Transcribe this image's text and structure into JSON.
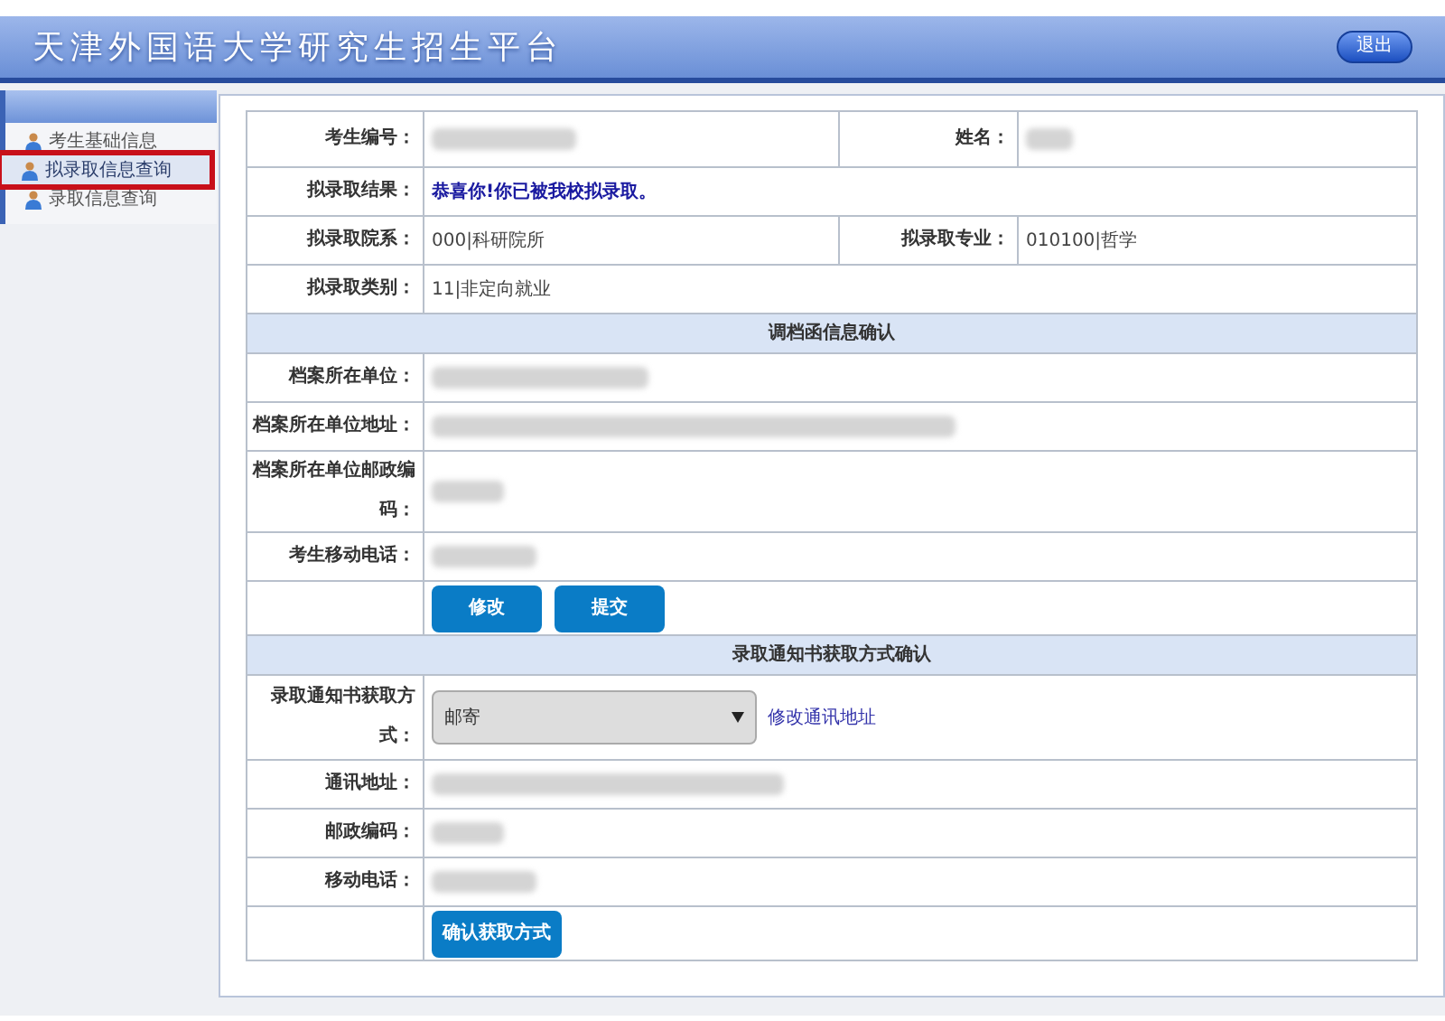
{
  "header": {
    "title": "天津外国语大学研究生招生平台",
    "logout_button": "退出"
  },
  "sidebar": {
    "items": [
      {
        "label": "考生基础信息",
        "selected": false,
        "highlighted": false
      },
      {
        "label": "拟录取信息查询",
        "selected": true,
        "highlighted": true
      },
      {
        "label": "录取信息查询",
        "selected": false,
        "highlighted": false
      }
    ]
  },
  "rows": [
    {
      "kind": "fields",
      "cells": [
        {
          "label": "考生编号：",
          "redacted": true
        },
        {
          "label": "姓名：",
          "redacted": true
        }
      ]
    },
    {
      "kind": "fields",
      "cells": [
        {
          "label": "拟录取结果：",
          "value": "恭喜你!你已被我校拟录取。",
          "emphasis": true
        }
      ]
    },
    {
      "kind": "fields",
      "cells": [
        {
          "label": "拟录取院系：",
          "value": "000|科研院所"
        },
        {
          "label": "拟录取专业：",
          "value": "010100|哲学"
        }
      ]
    },
    {
      "kind": "fields",
      "cells": [
        {
          "label": "拟录取类别：",
          "value": "11|非定向就业"
        }
      ]
    },
    {
      "kind": "section",
      "title": "调档函信息确认"
    },
    {
      "kind": "fields",
      "cells": [
        {
          "label": "档案所在单位：",
          "redacted": true
        }
      ]
    },
    {
      "kind": "fields",
      "cells": [
        {
          "label": "档案所在单位地址：",
          "redacted": true
        }
      ]
    },
    {
      "kind": "fields",
      "cells": [
        {
          "label": "档案所在单位邮政编码：",
          "redacted": true
        }
      ]
    },
    {
      "kind": "fields",
      "cells": [
        {
          "label": "考生移动电话：",
          "redacted": true
        }
      ]
    },
    {
      "kind": "buttons",
      "buttons": [
        "修改",
        "提交"
      ]
    },
    {
      "kind": "section",
      "title": "录取通知书获取方式确认"
    },
    {
      "kind": "select",
      "label": "录取通知书获取方式：",
      "value": "邮寄",
      "link": "修改通讯地址"
    },
    {
      "kind": "fields",
      "cells": [
        {
          "label": "通讯地址：",
          "redacted": true
        }
      ]
    },
    {
      "kind": "fields",
      "cells": [
        {
          "label": "邮政编码：",
          "redacted": true
        }
      ]
    },
    {
      "kind": "fields",
      "cells": [
        {
          "label": "移动电话：",
          "redacted": true
        }
      ]
    },
    {
      "kind": "buttons",
      "buttons": [
        "确认获取方式"
      ]
    }
  ]
}
